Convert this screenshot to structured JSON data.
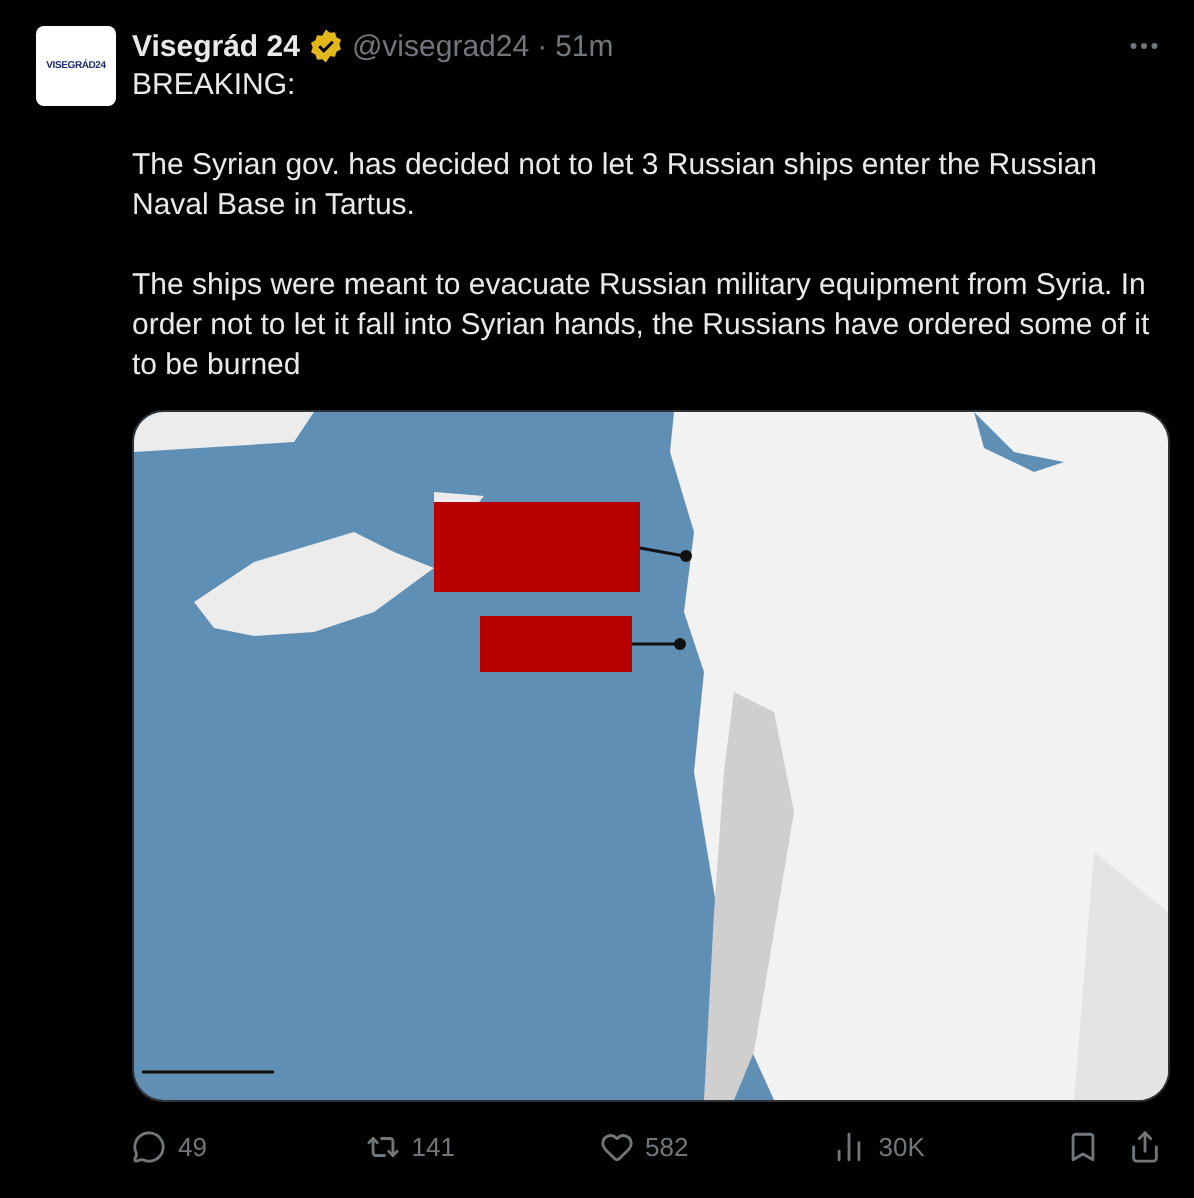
{
  "tweet": {
    "avatar_text": "VISEGRÁD24",
    "name": "Visegrád 24",
    "verified": true,
    "handle": "@visegrad24",
    "separator": "·",
    "time": "51m",
    "paragraphs": [
      "BREAKING:",
      "The Syrian gov. has decided not to let 3 Russian ships enter the Russian Naval Base in Tartus.",
      "The ships were meant to evacuate Russian military equipment from Syria. In order not to let it fall into Syrian hands, the Russians have ordered some of it to be burned"
    ],
    "media": {
      "kind": "picture"
    },
    "actions": [
      {
        "kind": "reply",
        "count": "49"
      },
      {
        "kind": "repost",
        "count": "141"
      },
      {
        "kind": "like",
        "count": "582"
      },
      {
        "kind": "views",
        "count": "30K"
      }
    ]
  }
}
